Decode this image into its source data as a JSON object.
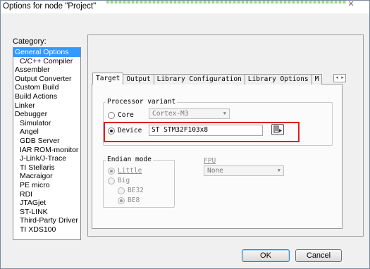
{
  "window": {
    "title": "Options for node \"Project\"",
    "close_glyph": "✕"
  },
  "category": {
    "label": "Category:",
    "items": [
      {
        "label": "General Options",
        "level": 0,
        "selected": true
      },
      {
        "label": "C/C++ Compiler",
        "level": 1
      },
      {
        "label": "Assembler",
        "level": 0
      },
      {
        "label": "Output Converter",
        "level": 0
      },
      {
        "label": "Custom Build",
        "level": 0
      },
      {
        "label": "Build Actions",
        "level": 0
      },
      {
        "label": "Linker",
        "level": 0
      },
      {
        "label": "Debugger",
        "level": 0
      },
      {
        "label": "Simulator",
        "level": 1
      },
      {
        "label": "Angel",
        "level": 1
      },
      {
        "label": "GDB Server",
        "level": 1
      },
      {
        "label": "IAR ROM-monitor",
        "level": 1
      },
      {
        "label": "J-Link/J-Trace",
        "level": 1
      },
      {
        "label": "TI Stellaris",
        "level": 1
      },
      {
        "label": "Macraigor",
        "level": 1
      },
      {
        "label": "PE micro",
        "level": 1
      },
      {
        "label": "RDI",
        "level": 1
      },
      {
        "label": "JTAGjet",
        "level": 1
      },
      {
        "label": "ST-LINK",
        "level": 1
      },
      {
        "label": "Third-Party Driver",
        "level": 1
      },
      {
        "label": "TI XDS100",
        "level": 1
      }
    ]
  },
  "tabs": [
    {
      "label": "Target",
      "active": true
    },
    {
      "label": "Output"
    },
    {
      "label": "Library Configuration"
    },
    {
      "label": "Library Options"
    },
    {
      "label": "M"
    }
  ],
  "tab_scroll": {
    "left": "◂",
    "right": "▸"
  },
  "processor": {
    "legend": "Processor variant",
    "core_label": "Core",
    "core_value": "Cortex-M3",
    "device_label": "Device",
    "device_value": "ST STM32F103x8",
    "selected": "device"
  },
  "endian": {
    "legend": "Endian mode",
    "little_label": "Little",
    "big_label": "Big",
    "be32_label": "BE32",
    "be8_label": "BE8"
  },
  "fpu": {
    "legend": "FPU",
    "value": "None"
  },
  "buttons": {
    "ok": "OK",
    "cancel": "Cancel"
  },
  "accent_colors": {
    "selection": "#3399ff",
    "highlight": "#e11d1d"
  }
}
